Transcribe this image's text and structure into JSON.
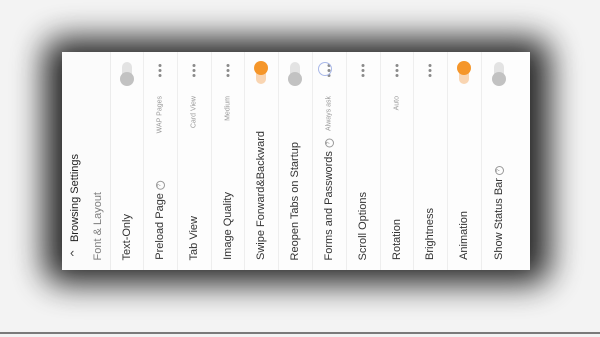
{
  "header": {
    "title": "Browsing Settings",
    "partial_item": "Font & Layout"
  },
  "settings": [
    {
      "label": "Text-Only",
      "control": "toggle",
      "state": "off"
    },
    {
      "label": "Preload Page",
      "control": "value",
      "value": "WAP Pages",
      "info": true
    },
    {
      "label": "Tab View",
      "control": "value",
      "value": "Card View"
    },
    {
      "label": "Image Quality",
      "control": "value",
      "value": "Medium"
    },
    {
      "label": "Swipe Forward&Backward",
      "control": "toggle",
      "state": "on"
    },
    {
      "label": "Reopen Tabs on Startup",
      "control": "toggle",
      "state": "off"
    },
    {
      "label": "Forms and Passwords",
      "control": "value",
      "value": "Always ask",
      "info": true
    },
    {
      "label": "Scroll Options",
      "control": "dots"
    },
    {
      "label": "Rotation",
      "control": "value",
      "value": "Auto"
    },
    {
      "label": "Brightness",
      "control": "dots"
    },
    {
      "label": "Animation",
      "control": "toggle",
      "state": "on"
    },
    {
      "label": "Show Status Bar",
      "control": "toggle",
      "state": "off",
      "info": true
    }
  ],
  "colors": {
    "accent": "#f5962a",
    "toggle_off": "#c2c2c2"
  }
}
